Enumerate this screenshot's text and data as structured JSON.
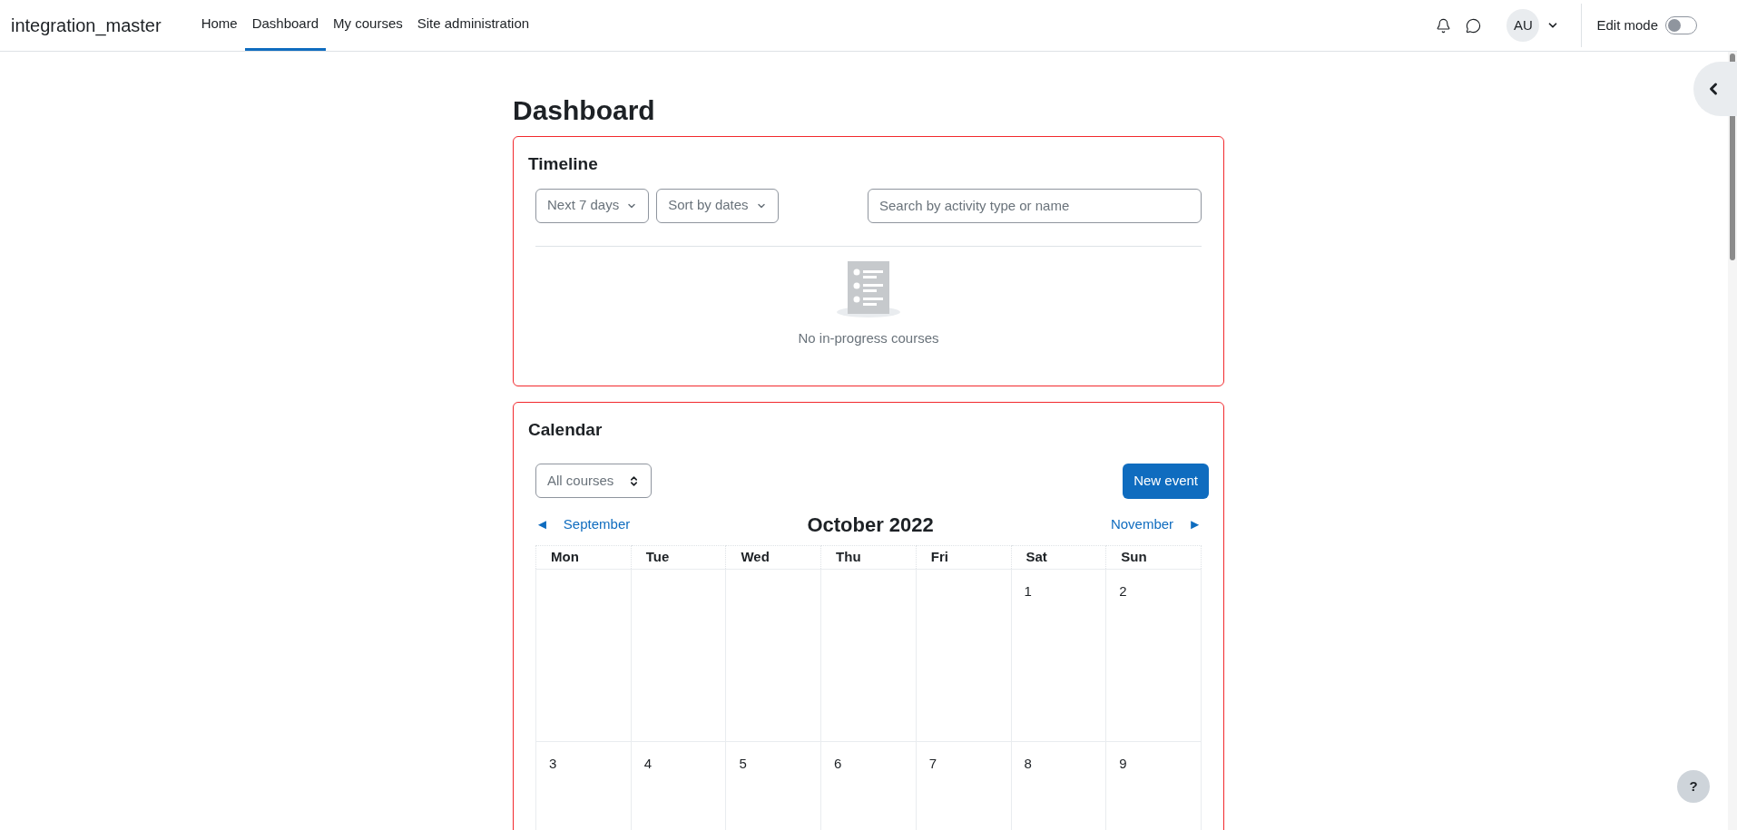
{
  "navbar": {
    "site_name": "integration_master",
    "items": [
      {
        "label": "Home",
        "selected": false
      },
      {
        "label": "Dashboard",
        "selected": true
      },
      {
        "label": "My courses",
        "selected": false
      },
      {
        "label": "Site administration",
        "selected": false
      }
    ],
    "avatar": "AU",
    "edit_mode": {
      "label": "Edit mode",
      "on": false
    }
  },
  "page_title": "Dashboard",
  "timeline": {
    "title": "Timeline",
    "filters": [
      "Next 7 days",
      "Sort by dates"
    ],
    "search": {
      "placeholder": "Search by activity type or name"
    },
    "empty_message": "No in-progress courses"
  },
  "calendar": {
    "title": "Calendar",
    "course_select": "All courses",
    "new_event": "New event",
    "prev": {
      "arrow": "◄",
      "label": "September"
    },
    "month": "October 2022",
    "next": {
      "arrow": "►",
      "label": "November"
    },
    "weekdays": [
      "Mon",
      "Tue",
      "Wed",
      "Thu",
      "Fri",
      "Sat",
      "Sun"
    ],
    "weeks": [
      [
        {
          "kind": "blank"
        },
        {
          "kind": "blank"
        },
        {
          "kind": "blank"
        },
        {
          "kind": "blank"
        },
        {
          "kind": "blank"
        },
        {
          "kind": "date",
          "day": "1"
        },
        {
          "kind": "date",
          "day": "2"
        }
      ],
      [
        {
          "kind": "date",
          "day": "3"
        },
        {
          "kind": "date",
          "day": "4"
        },
        {
          "kind": "date",
          "day": "5"
        },
        {
          "kind": "date",
          "day": "6"
        },
        {
          "kind": "date",
          "day": "7"
        },
        {
          "kind": "date",
          "day": "8"
        },
        {
          "kind": "date",
          "day": "9"
        }
      ]
    ]
  },
  "help_button": "?"
}
